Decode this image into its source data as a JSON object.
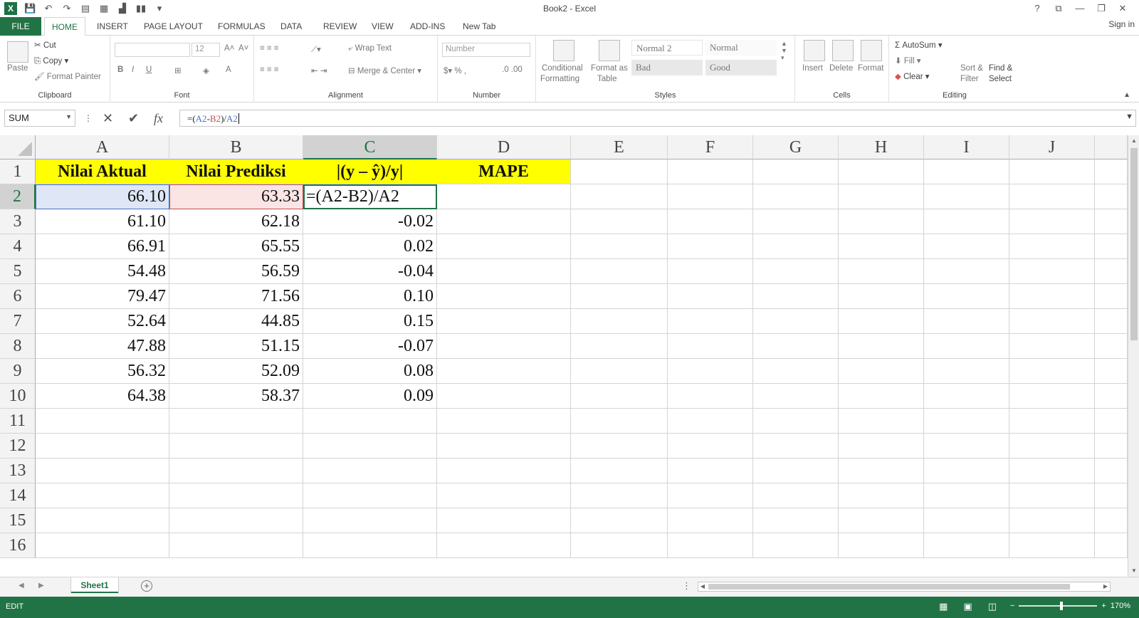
{
  "window": {
    "title": "Book2 - Excel",
    "help": "?",
    "min": "—",
    "restore": "❐",
    "close": "✕",
    "ribbon_opts": "⧉"
  },
  "qat": {
    "logo": "X"
  },
  "tabs": [
    "FILE",
    "HOME",
    "INSERT",
    "PAGE LAYOUT",
    "FORMULAS",
    "DATA",
    "REVIEW",
    "VIEW",
    "ADD-INS",
    "New Tab"
  ],
  "active_tab": "HOME",
  "sign_in": "Sign in",
  "ribbon": {
    "clipboard": {
      "label": "Clipboard",
      "paste": "Paste",
      "cut": "Cut",
      "copy": "Copy",
      "format_painter": "Format Painter"
    },
    "font": {
      "label": "Font",
      "font_name": "",
      "font_size": "12",
      "bold": "B",
      "italic": "I",
      "underline": "U"
    },
    "alignment": {
      "label": "Alignment",
      "wrap_text": "Wrap Text",
      "merge_center": "Merge & Center"
    },
    "number": {
      "label": "Number",
      "format": "Number"
    },
    "styles": {
      "label": "Styles",
      "conditional": "Conditional",
      "conditional2": "Formatting",
      "format_as": "Format as",
      "format_as2": "Table",
      "normal2": "Normal 2",
      "normal": "Normal",
      "bad": "Bad",
      "good": "Good"
    },
    "cells": {
      "label": "Cells",
      "insert": "Insert",
      "delete": "Delete",
      "format": "Format"
    },
    "editing": {
      "label": "Editing",
      "autosum": "AutoSum",
      "fill": "Fill",
      "clear": "Clear",
      "sort": "Sort &",
      "sort2": "Filter",
      "find": "Find &",
      "find2": "Select"
    }
  },
  "formula_bar": {
    "name_box": "SUM",
    "fx": "fx",
    "formula_prefix": "=(",
    "ref_a": "A2",
    "minus": "-",
    "ref_b": "B2",
    "suffix": ")/",
    "ref_a2": "A2"
  },
  "columns": [
    "A",
    "B",
    "C",
    "D",
    "E",
    "F",
    "G",
    "H",
    "I",
    "J"
  ],
  "rows": [
    "1",
    "2",
    "3",
    "4",
    "5",
    "6",
    "7",
    "8",
    "9",
    "10",
    "11",
    "12",
    "13",
    "14",
    "15",
    "16"
  ],
  "sheet": {
    "headers": [
      "Nilai Aktual",
      "Nilai Prediksi",
      "|(y – ŷ)/y|",
      "MAPE"
    ],
    "data": [
      [
        "66.10",
        "63.33",
        "=(A2-B2)/A2"
      ],
      [
        "61.10",
        "62.18",
        "-0.02"
      ],
      [
        "66.91",
        "65.55",
        "0.02"
      ],
      [
        "54.48",
        "56.59",
        "-0.04"
      ],
      [
        "79.47",
        "71.56",
        "0.10"
      ],
      [
        "52.64",
        "44.85",
        "0.15"
      ],
      [
        "47.88",
        "51.15",
        "-0.07"
      ],
      [
        "56.32",
        "52.09",
        "0.08"
      ],
      [
        "64.38",
        "58.37",
        "0.09"
      ]
    ]
  },
  "sheet_tabs": [
    "Sheet1"
  ],
  "status": {
    "mode": "EDIT",
    "zoom": "170%"
  },
  "colors": {
    "excel_green": "#217346",
    "header_yellow": "#ffff00",
    "ref_blue": "#4472c4",
    "ref_red": "#c0504d"
  }
}
